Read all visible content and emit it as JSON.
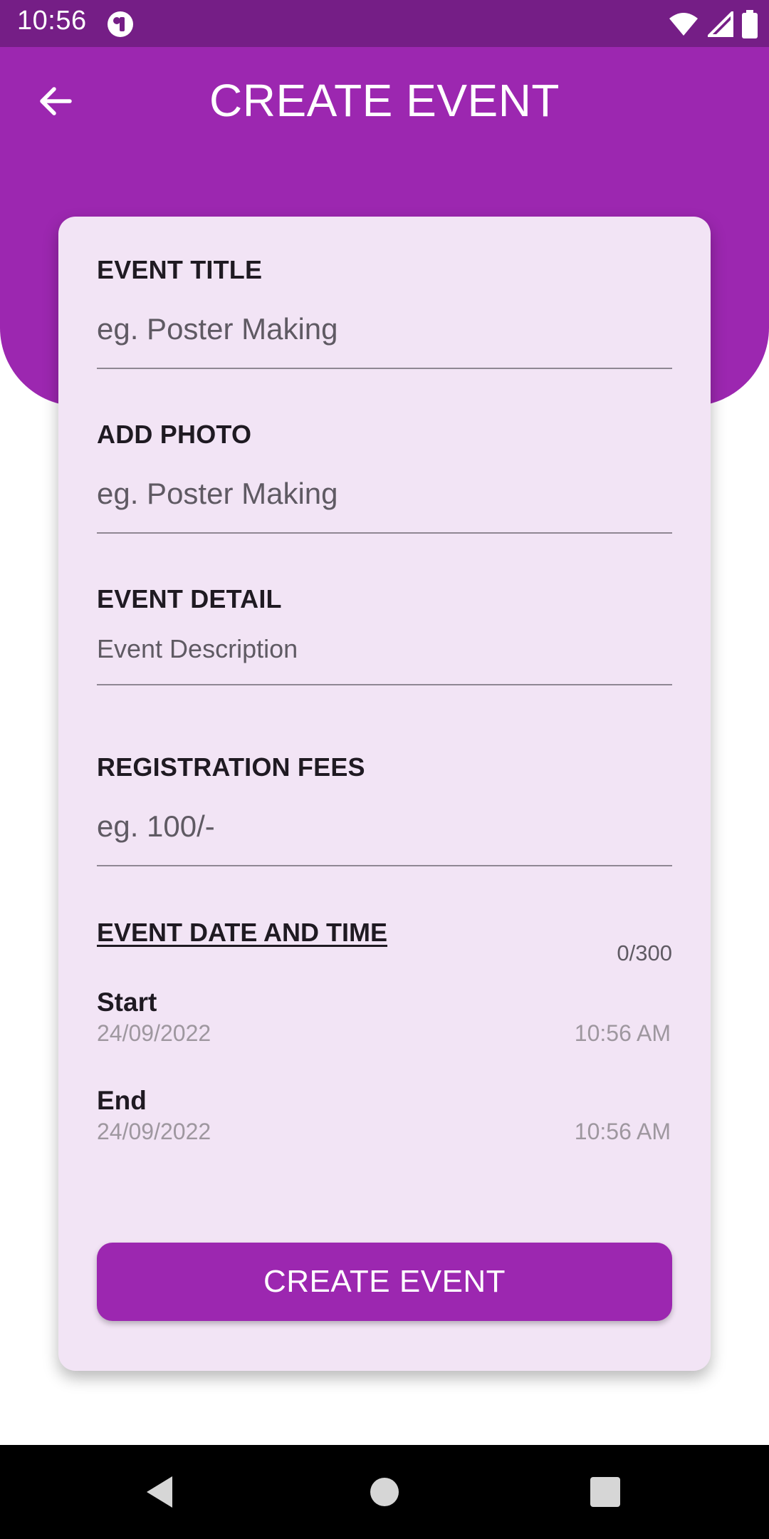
{
  "status_bar": {
    "time": "10:56"
  },
  "header": {
    "title": "CREATE EVENT"
  },
  "form": {
    "event_title": {
      "label": "EVENT TITLE",
      "placeholder": "eg. Poster Making"
    },
    "add_photo": {
      "label": "ADD PHOTO",
      "placeholder": "eg. Poster Making"
    },
    "event_detail": {
      "label": "EVENT DETAIL",
      "placeholder": "Event Description",
      "counter": "0/300"
    },
    "registration_fees": {
      "label": "REGISTRATION FEES",
      "placeholder": "eg. 100/-"
    },
    "date_time": {
      "heading": "EVENT DATE AND TIME",
      "start": {
        "label": "Start",
        "date": "24/09/2022",
        "time": "10:56 AM"
      },
      "end": {
        "label": "End",
        "date": "24/09/2022",
        "time": "10:56 AM"
      }
    },
    "submit_label": "CREATE EVENT"
  },
  "colors": {
    "status_bar": "#751e86",
    "primary": "#9c27b0",
    "card": "#f2e4f5",
    "nav_bar": "#000000"
  },
  "icons": {
    "back": "arrow-back-icon",
    "wifi": "wifi-icon",
    "signal": "signal-icon",
    "battery": "battery-icon",
    "nav_back": "nav-back-icon",
    "nav_home": "nav-home-icon",
    "nav_recents": "nav-recents-icon"
  }
}
